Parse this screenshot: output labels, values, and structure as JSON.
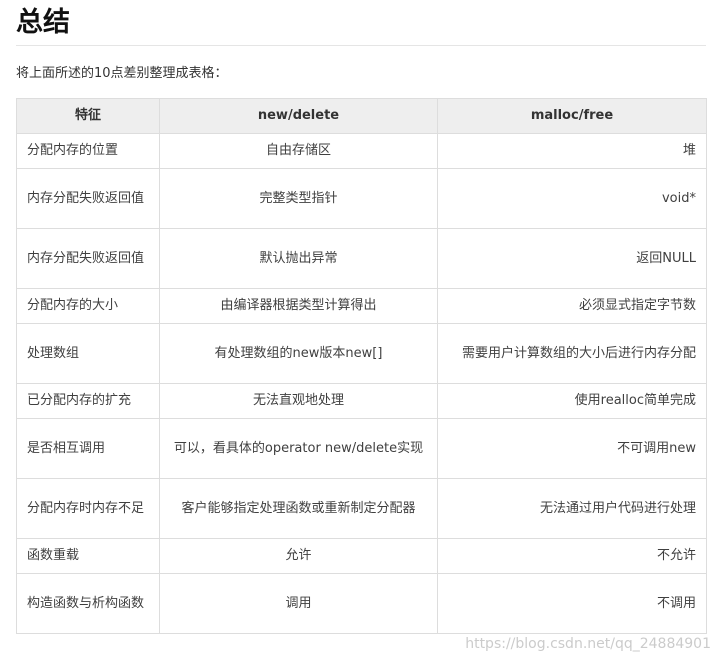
{
  "heading": "总结",
  "intro": "将上面所述的10点差别整理成表格：",
  "table": {
    "headers": [
      "特征",
      "new/delete",
      "malloc/free"
    ],
    "rows": [
      [
        "分配内存的位置",
        "自由存储区",
        "堆"
      ],
      [
        "内存分配失败返回值",
        "完整类型指针",
        "void*"
      ],
      [
        "内存分配失败返回值",
        "默认抛出异常",
        "返回NULL"
      ],
      [
        "分配内存的大小",
        "由编译器根据类型计算得出",
        "必须显式指定字节数"
      ],
      [
        "处理数组",
        "有处理数组的new版本new[]",
        "需要用户计算数组的大小后进行内存分配"
      ],
      [
        "已分配内存的扩充",
        "无法直观地处理",
        "使用realloc简单完成"
      ],
      [
        "是否相互调用",
        "可以，看具体的operator new/delete实现",
        "不可调用new"
      ],
      [
        "分配内存时内存不足",
        "客户能够指定处理函数或重新制定分配器",
        "无法通过用户代码进行处理"
      ],
      [
        "函数重载",
        "允许",
        "不允许"
      ],
      [
        "构造函数与析构函数",
        "调用",
        "不调用"
      ]
    ]
  },
  "watermark": "https://blog.csdn.net/qq_24884901"
}
